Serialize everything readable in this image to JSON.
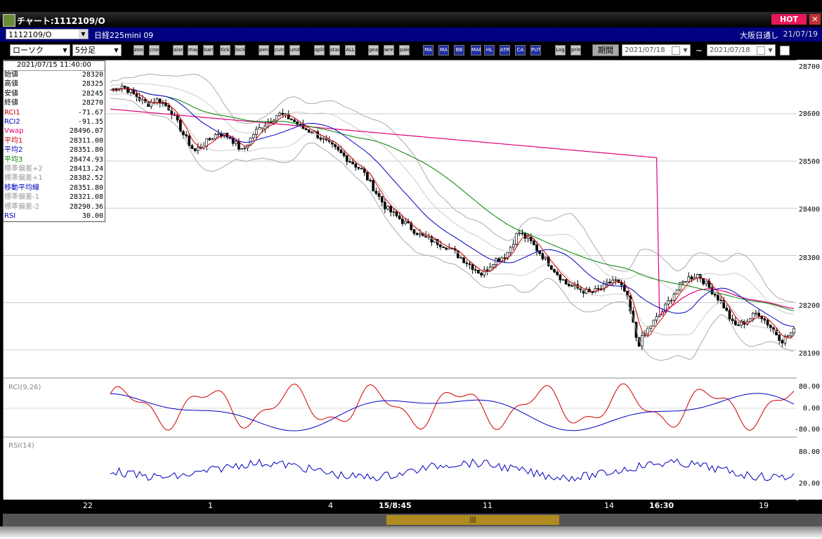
{
  "window": {
    "title": "チャート:1112109/O",
    "hot_label": "HOT",
    "close_label": "✕"
  },
  "infobar": {
    "symbol": "1112109/O",
    "instrument": "日経225mini 09",
    "market": "大阪日通し",
    "date": "21/07/19"
  },
  "toolbar": {
    "chart_type": "ローソク",
    "interval": "5分足",
    "period_label": "期間",
    "date_from": "2021/07/18",
    "date_to": "2021/07/18",
    "range_separator": "~",
    "buttons": [
      "zoom",
      "crosshair",
      "alarm",
      "magnify",
      "bars",
      "tick",
      "lock",
      "pen",
      "cursor",
      "undo",
      "split",
      "stack",
      "ALL",
      "gear",
      "wrench",
      "palette",
      "MA",
      "MA",
      "BB",
      "MAE",
      "HL",
      "ATR",
      "CA",
      "PUT",
      "Log",
      "print"
    ]
  },
  "data_panel": {
    "timestamp": "2021/07/15  11:40:00",
    "rows": [
      {
        "label": "始値",
        "value": "28320",
        "color": "#000000"
      },
      {
        "label": "高値",
        "value": "28325",
        "color": "#000000"
      },
      {
        "label": "安値",
        "value": "28245",
        "color": "#000000"
      },
      {
        "label": "終値",
        "value": "28270",
        "color": "#000000"
      },
      {
        "label": "RCI1",
        "value": "-71.67",
        "color": "#d00000"
      },
      {
        "label": "RCI2",
        "value": "-91.35",
        "color": "#0000c0"
      },
      {
        "label": "Vwap",
        "value": "28496.07",
        "color": "#e0007a"
      },
      {
        "label": "平均1",
        "value": "28311.00",
        "color": "#d00000"
      },
      {
        "label": "平均2",
        "value": "28351.80",
        "color": "#0000c0"
      },
      {
        "label": "平均3",
        "value": "28474.93",
        "color": "#008000"
      },
      {
        "label": "標準偏差+2",
        "value": "28413.24",
        "color": "#999999"
      },
      {
        "label": "標準偏差+1",
        "value": "28382.52",
        "color": "#999999"
      },
      {
        "label": "移動平均線",
        "value": "28351.80",
        "color": "#0000c0"
      },
      {
        "label": "標準偏差-1",
        "value": "28321.08",
        "color": "#999999"
      },
      {
        "label": "標準偏差-2",
        "value": "28290.36",
        "color": "#999999"
      },
      {
        "label": "RSI",
        "value": "30.00",
        "color": "#0000c0"
      }
    ]
  },
  "chart_data": {
    "type": "candlestick",
    "price_axis": {
      "labels": [
        "28700",
        "28600",
        "28500",
        "28400",
        "28300",
        "28200",
        "28100"
      ],
      "ylim": [
        28070,
        28710
      ]
    },
    "x_axis_labels": [
      {
        "label": "22",
        "bold": false
      },
      {
        "label": "1",
        "bold": false
      },
      {
        "label": "4",
        "bold": false
      },
      {
        "label": "15/8:45",
        "bold": true
      },
      {
        "label": "11",
        "bold": false
      },
      {
        "label": "14",
        "bold": false
      },
      {
        "label": "16:30",
        "bold": true
      },
      {
        "label": "19",
        "bold": false
      }
    ],
    "price_path": [
      28650,
      28660,
      28640,
      28620,
      28630,
      28610,
      28560,
      28520,
      28540,
      28560,
      28550,
      28520,
      28560,
      28580,
      28600,
      28590,
      28570,
      28560,
      28540,
      28520,
      28500,
      28480,
      28440,
      28400,
      28380,
      28360,
      28340,
      28330,
      28320,
      28300,
      28280,
      28260,
      28290,
      28300,
      28350,
      28330,
      28300,
      28270,
      28240,
      28230,
      28220,
      28230,
      28250,
      28220,
      28110,
      28150,
      28180,
      28220,
      28250,
      28260,
      28230,
      28200,
      28150,
      28160,
      28180,
      28150,
      28120,
      28140
    ],
    "rci_panel": {
      "label": "RCI(9,26)",
      "axis_labels": [
        "80.00",
        "0.00",
        "-80.00"
      ]
    },
    "rsi_panel": {
      "label": "RSI(14)",
      "axis_labels": [
        "80.00",
        "20.00"
      ]
    }
  }
}
